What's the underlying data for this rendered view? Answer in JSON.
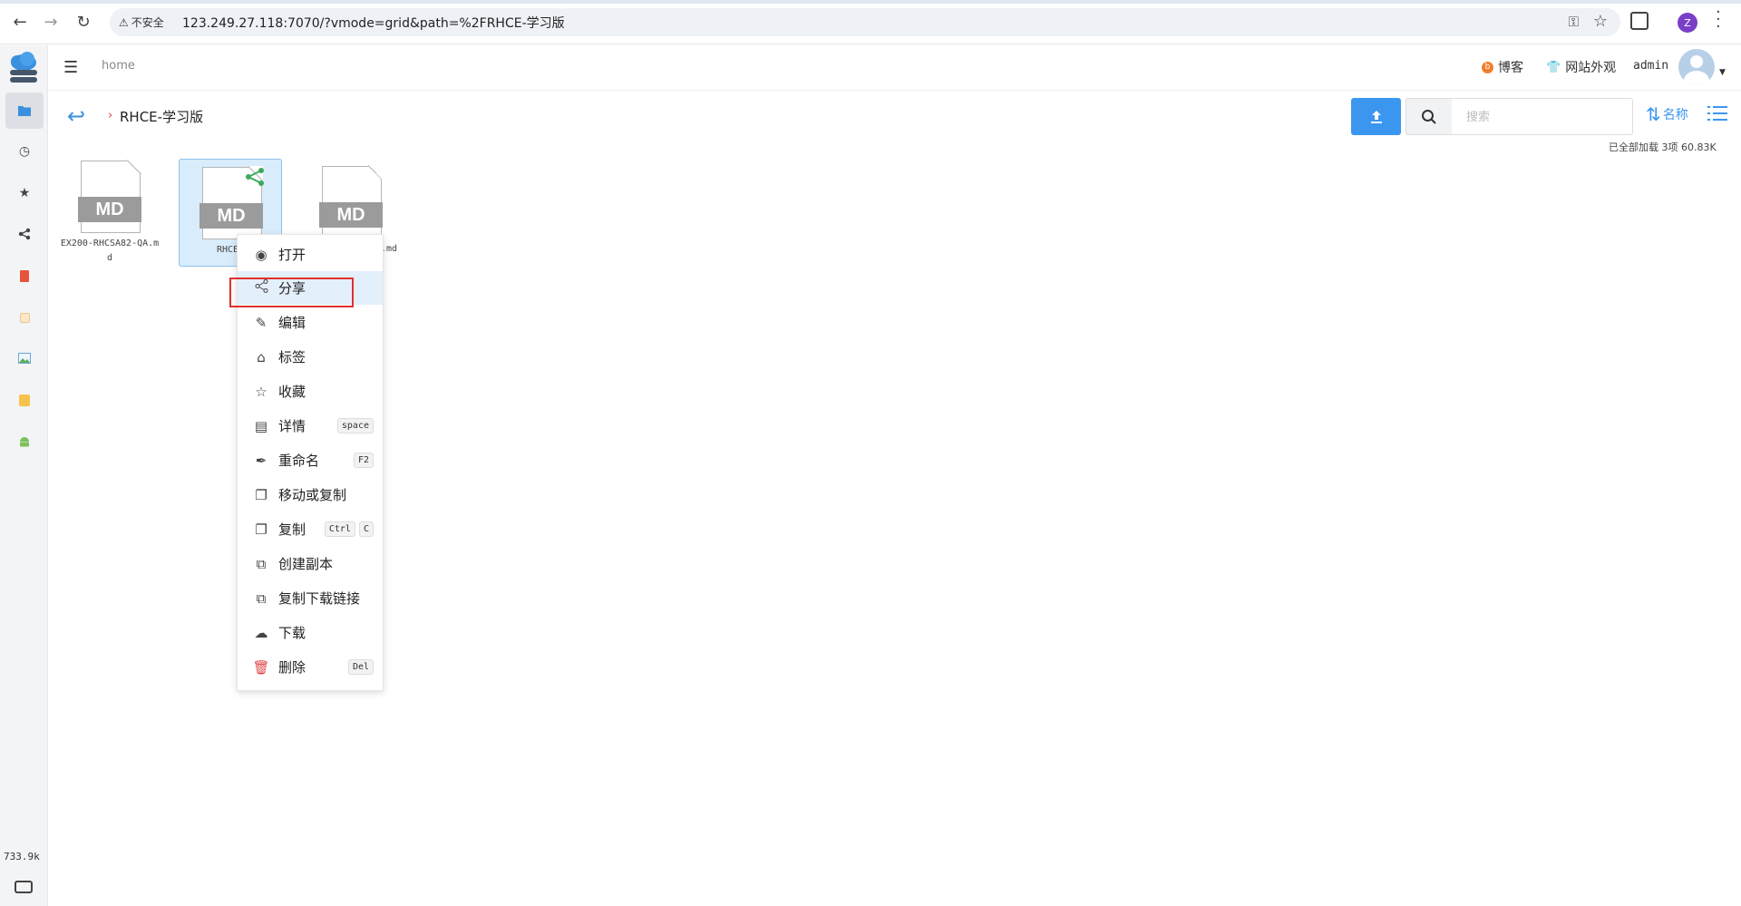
{
  "browser": {
    "security_label": "不安全",
    "url": "123.249.27.118:7070/?vmode=grid&path=%2FRHCE-学习版",
    "profile_initial": "Z"
  },
  "header": {
    "breadcrumb_home": "home",
    "blog_label": "博客",
    "appearance_label": "网站外观",
    "user_name": "admin"
  },
  "sidebar": {
    "items": [
      {
        "name": "folder",
        "icon": "folder-icon"
      },
      {
        "name": "recent",
        "icon": "clock-icon"
      },
      {
        "name": "favorites",
        "icon": "star-icon"
      },
      {
        "name": "share",
        "icon": "share-icon"
      },
      {
        "name": "doc-red",
        "icon": "document-icon"
      },
      {
        "name": "doc-light",
        "icon": "note-icon"
      },
      {
        "name": "image",
        "icon": "image-icon"
      },
      {
        "name": "notes",
        "icon": "notes-icon"
      },
      {
        "name": "android",
        "icon": "android-icon"
      }
    ],
    "storage_used": "733.9k"
  },
  "toolbar": {
    "current_folder": "RHCE-学习版",
    "search_placeholder": "搜索",
    "sort_label": "名称",
    "load_status": "已全部加载 3项 60.83K"
  },
  "files": [
    {
      "badge": "MD",
      "name": "EX200-RHCSA82-QA.md",
      "selected": false
    },
    {
      "badge": "MD",
      "name": "RHCE.",
      "selected": true
    },
    {
      "badge": "MD",
      "name": ".md",
      "selected": false
    }
  ],
  "context_menu": {
    "items": [
      {
        "label": "打开",
        "icon": "eye-icon"
      },
      {
        "label": "分享",
        "icon": "share-icon"
      },
      {
        "label": "编辑",
        "icon": "edit-icon"
      },
      {
        "label": "标签",
        "icon": "tag-icon"
      },
      {
        "label": "收藏",
        "icon": "star-icon"
      },
      {
        "label": "详情",
        "icon": "details-icon",
        "keys": [
          "space"
        ]
      },
      {
        "label": "重命名",
        "icon": "rename-icon",
        "keys": [
          "F2"
        ]
      },
      {
        "label": "移动或复制",
        "icon": "move-icon"
      },
      {
        "label": "复制",
        "icon": "copy-icon",
        "keys": [
          "Ctrl",
          "C"
        ]
      },
      {
        "label": "创建副本",
        "icon": "duplicate-icon"
      },
      {
        "label": "复制下载链接",
        "icon": "link-icon"
      },
      {
        "label": "下载",
        "icon": "cloud-download-icon"
      },
      {
        "label": "删除",
        "icon": "trash-icon",
        "keys": [
          "Del"
        ]
      }
    ],
    "hovered_index": 1
  },
  "colors": {
    "accent": "#3b96f0",
    "highlight_box": "#e03030",
    "selected_tile": "#d9ecfb"
  }
}
